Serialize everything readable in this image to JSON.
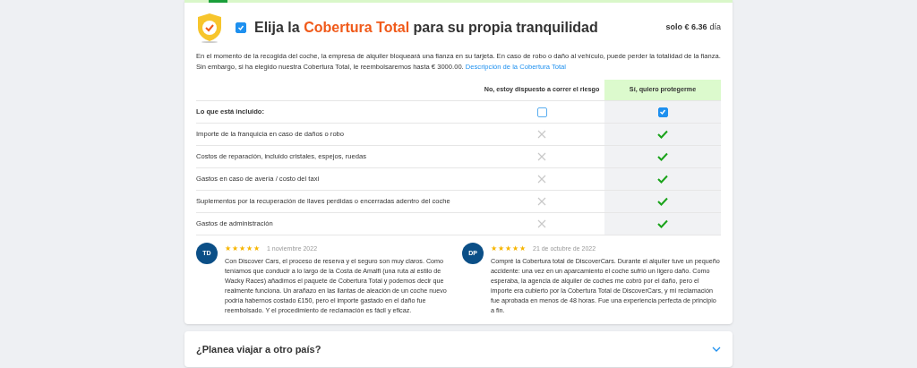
{
  "coverage": {
    "checked": true,
    "title_before": "Elija la",
    "title_highlight": "Cobertura Total",
    "title_after": "para su propia tranquilidad",
    "price": "solo € 6.36",
    "price_unit": "día",
    "description": "En el momento de la recogida del coche, la empresa de alquiler bloqueará una fianza en su tarjeta. En caso de robo o daño al vehículo, puede perder la totalidad de la fianza. Sin embargo, si ha elegido nuestra Cobertura Total, le reembolsaremos hasta € 3000.00.",
    "link": "Descripción de la Cobertura Total"
  },
  "table": {
    "columns": [
      {
        "label": "No, estoy dispuesto a correr el riesgo",
        "selected": false
      },
      {
        "label": "Sí, quiero protegerme",
        "selected": true
      }
    ],
    "rows": [
      {
        "kind": "choice",
        "label": "Lo que está incluido:",
        "no": false,
        "yes": true
      },
      {
        "kind": "feature",
        "label": "Importe de la franquicia en caso de daños o robo",
        "no": false,
        "yes": true
      },
      {
        "kind": "feature",
        "label": "Costos de reparación, incluido cristales, espejos, ruedas",
        "no": false,
        "yes": true
      },
      {
        "kind": "feature",
        "label": "Gastos en caso de avería / costo del taxi",
        "no": false,
        "yes": true
      },
      {
        "kind": "feature",
        "label": "Suplementos por la recuperación de llaves perdidas o encerradas adentro del coche",
        "no": false,
        "yes": true
      },
      {
        "kind": "feature",
        "label": "Gastos de administración",
        "no": false,
        "yes": true
      }
    ]
  },
  "reviews": [
    {
      "initials": "TD",
      "stars": 5,
      "date": "1 noviembre 2022",
      "text": "Con Discover Cars, el proceso de reserva y el seguro son muy claros. Como teníamos que conducir a lo largo de la Costa de Amalfi (una ruta al estilo de Wacky Races) añadimos el paquete de Cobertura Total y podemos decir que realmente funciona. Un arañazo en las llantas de aleación de un coche nuevo podría habernos costado £150, pero el importe gastado en el daño fue reembolsado. Y el procedimiento de reclamación es fácil y eficaz."
    },
    {
      "initials": "DP",
      "stars": 5,
      "date": "21 de octubre de 2022",
      "text": "Compré la Cobertura total de DiscoverCars. Durante el alquiler tuve un pequeño accidente: una vez en un aparcamiento el coche sufrió un ligero daño. Como esperaba, la agencia de alquiler de coches me cobró por el daño, pero el importe era cubierto por la Cobertura Total de DiscoverCars, y mi reclamación fue aprobada en menos de 48 horas. Fue una experiencia perfecta de principio a fin."
    }
  ],
  "accordion": {
    "title": "¿Planea viajar a otro país?",
    "expanded": false
  }
}
